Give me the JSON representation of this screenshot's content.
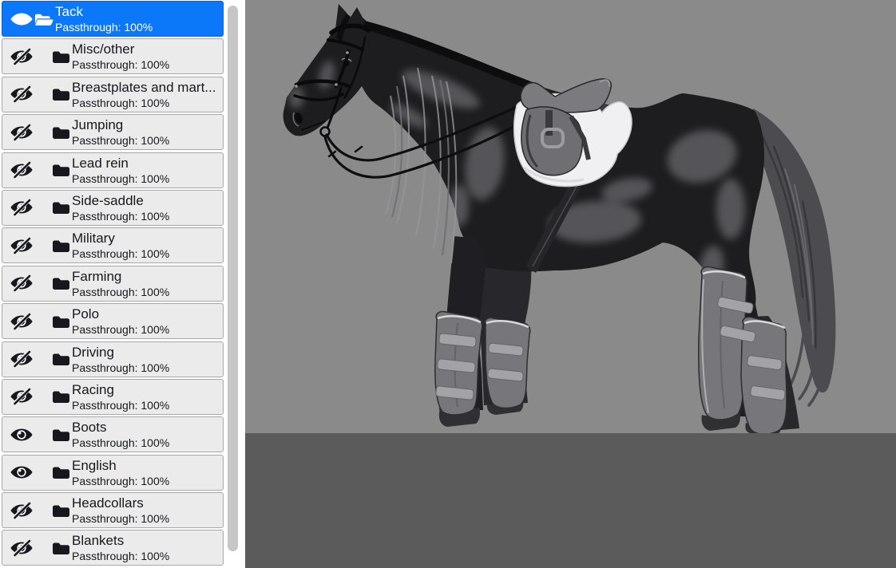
{
  "layers_panel": {
    "items": [
      {
        "name": "Tack",
        "detail": "Passthrough: 100%",
        "visible": true,
        "selected": true,
        "expanded": true,
        "child": false
      },
      {
        "name": "Misc/other",
        "detail": "Passthrough: 100%",
        "visible": false,
        "selected": false,
        "expanded": false,
        "child": true
      },
      {
        "name": "Breastplates and mart...",
        "detail": "Passthrough: 100%",
        "visible": false,
        "selected": false,
        "expanded": false,
        "child": true
      },
      {
        "name": "Jumping",
        "detail": "Passthrough: 100%",
        "visible": false,
        "selected": false,
        "expanded": false,
        "child": true
      },
      {
        "name": "Lead rein",
        "detail": "Passthrough: 100%",
        "visible": false,
        "selected": false,
        "expanded": false,
        "child": true
      },
      {
        "name": "Side-saddle",
        "detail": "Passthrough: 100%",
        "visible": false,
        "selected": false,
        "expanded": false,
        "child": true
      },
      {
        "name": "Military",
        "detail": "Passthrough: 100%",
        "visible": false,
        "selected": false,
        "expanded": false,
        "child": true
      },
      {
        "name": "Farming",
        "detail": "Passthrough: 100%",
        "visible": false,
        "selected": false,
        "expanded": false,
        "child": true
      },
      {
        "name": "Polo",
        "detail": "Passthrough: 100%",
        "visible": false,
        "selected": false,
        "expanded": false,
        "child": true
      },
      {
        "name": "Driving",
        "detail": "Passthrough: 100%",
        "visible": false,
        "selected": false,
        "expanded": false,
        "child": true
      },
      {
        "name": "Racing",
        "detail": "Passthrough: 100%",
        "visible": false,
        "selected": false,
        "expanded": false,
        "child": true
      },
      {
        "name": "Boots",
        "detail": "Passthrough: 100%",
        "visible": true,
        "selected": false,
        "expanded": false,
        "child": true
      },
      {
        "name": "English",
        "detail": "Passthrough: 100%",
        "visible": true,
        "selected": false,
        "expanded": false,
        "child": true
      },
      {
        "name": "Headcollars",
        "detail": "Passthrough: 100%",
        "visible": false,
        "selected": false,
        "expanded": false,
        "child": true
      },
      {
        "name": "Blankets",
        "detail": "Passthrough: 100%",
        "visible": false,
        "selected": false,
        "expanded": false,
        "child": true
      }
    ]
  },
  "canvas": {
    "background_color": "#8a8a8a",
    "pasteboard_color": "#5b5b5b",
    "artwork_description": "Grayscale digital painting of a dark horse facing left wearing a bridle with looped reins, an English saddle on a white fleece pad, and grey travel boots on all four legs"
  },
  "colors": {
    "selected_row_bg": "#0b78fa",
    "selected_row_border": "#0a63d6",
    "selected_row_text": "#ffffff",
    "row_bg": "#ebebeb",
    "row_border": "#a8a8a8",
    "row_text": "#16181d",
    "panel_bg": "#ffffff",
    "scrollbar_thumb": "#c6c6c6"
  },
  "icons": {
    "visible": "eye-icon",
    "hidden": "eye-slash-icon",
    "group_collapsed": "folder-icon",
    "group_expanded": "folder-open-icon"
  }
}
